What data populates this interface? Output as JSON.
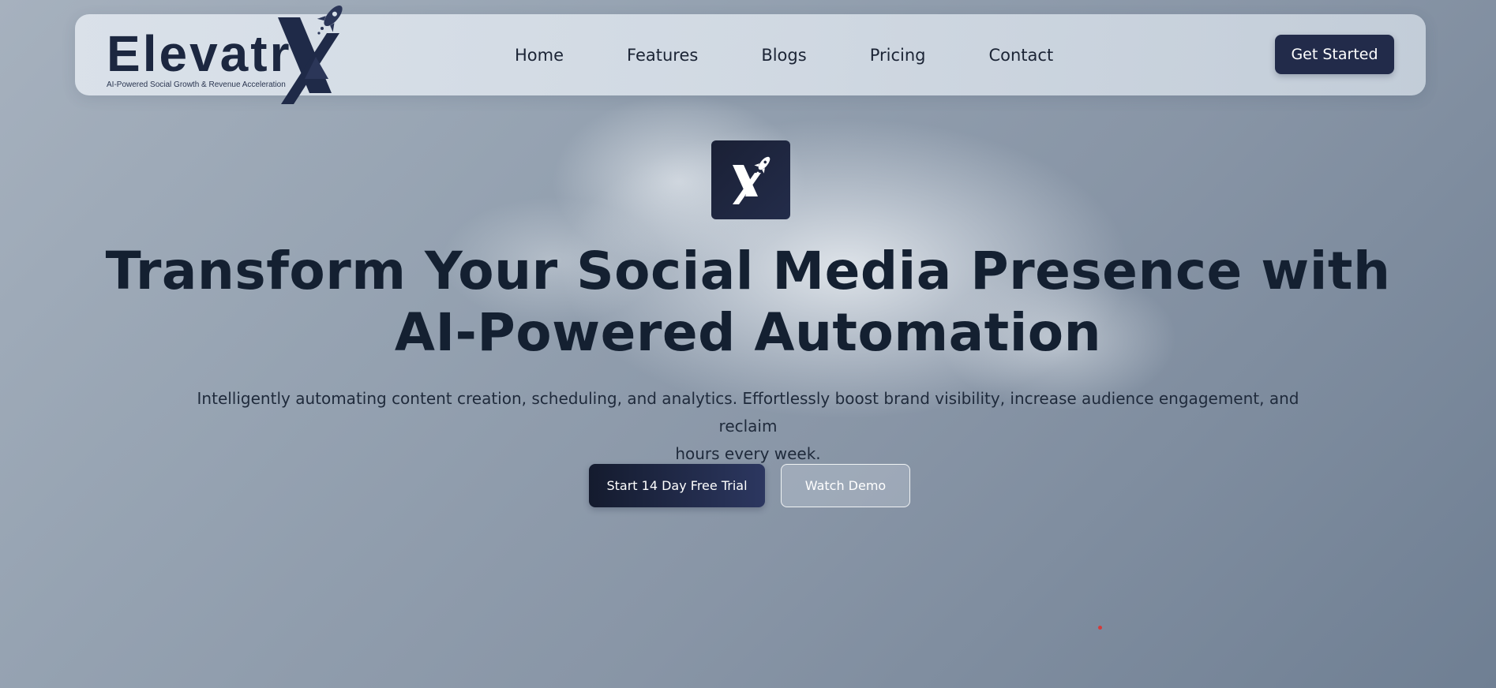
{
  "brand": {
    "name": "Elevatr",
    "tagline": "AI-Powered Social Growth & Revenue Acceleration"
  },
  "nav": {
    "items": [
      {
        "label": "Home"
      },
      {
        "label": "Features"
      },
      {
        "label": "Blogs"
      },
      {
        "label": "Pricing"
      },
      {
        "label": "Contact"
      }
    ],
    "cta_label": "Get Started"
  },
  "hero": {
    "icon": "x-rocket-logo-icon",
    "title_line1": "Transform Your Social Media Presence with",
    "title_line2": "AI-Powered Automation",
    "subtitle_line1": "Intelligently automating content creation, scheduling, and analytics. Effortlessly boost brand visibility, increase audience engagement, and reclaim",
    "subtitle_line2": "hours every week.",
    "primary_button": "Start 14 Day Free Trial",
    "secondary_button": "Watch Demo"
  },
  "colors": {
    "brand_navy": "#222b4a",
    "text_dark": "#142031",
    "accent_dot": "#d43a3a"
  }
}
